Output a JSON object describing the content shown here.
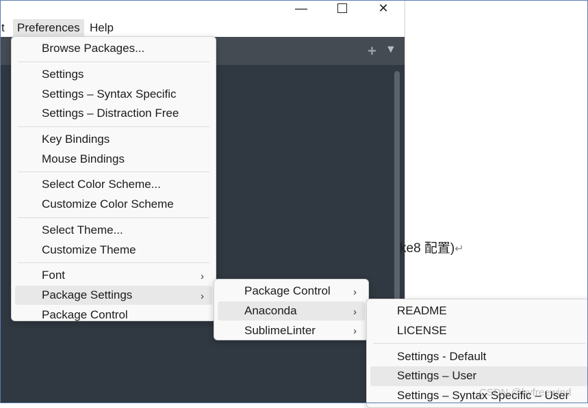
{
  "window": {
    "controls": {
      "minimize": "—",
      "maximize": "",
      "close": "✕"
    },
    "menubar": {
      "partial_item": "t",
      "preferences": "Preferences",
      "help": "Help"
    },
    "tabbar": {
      "plus": "+",
      "dropdown": "▼"
    }
  },
  "background_doc": {
    "text": "ke8 配置)",
    "return_mark": "↵"
  },
  "preferences_menu": {
    "groups": [
      [
        "Browse Packages..."
      ],
      [
        "Settings",
        "Settings – Syntax Specific",
        "Settings – Distraction Free"
      ],
      [
        "Key Bindings",
        "Mouse Bindings"
      ],
      [
        "Select Color Scheme...",
        "Customize Color Scheme"
      ],
      [
        "Select Theme...",
        "Customize Theme"
      ],
      [
        "Font",
        "Package Settings",
        "Package Control"
      ]
    ],
    "submenu_arrow": "›",
    "active": "Package Settings"
  },
  "package_settings_menu": {
    "items": [
      "Package Control",
      "Anaconda",
      "SublimeLinter"
    ],
    "active": "Anaconda"
  },
  "anaconda_menu": {
    "groups": [
      [
        "README",
        "LICENSE"
      ],
      [
        "Settings - Default",
        "Settings – User",
        "Settings – Syntax Specific – User"
      ]
    ],
    "active": "Settings – User"
  },
  "watermark": "CSDN @hyfreewind"
}
